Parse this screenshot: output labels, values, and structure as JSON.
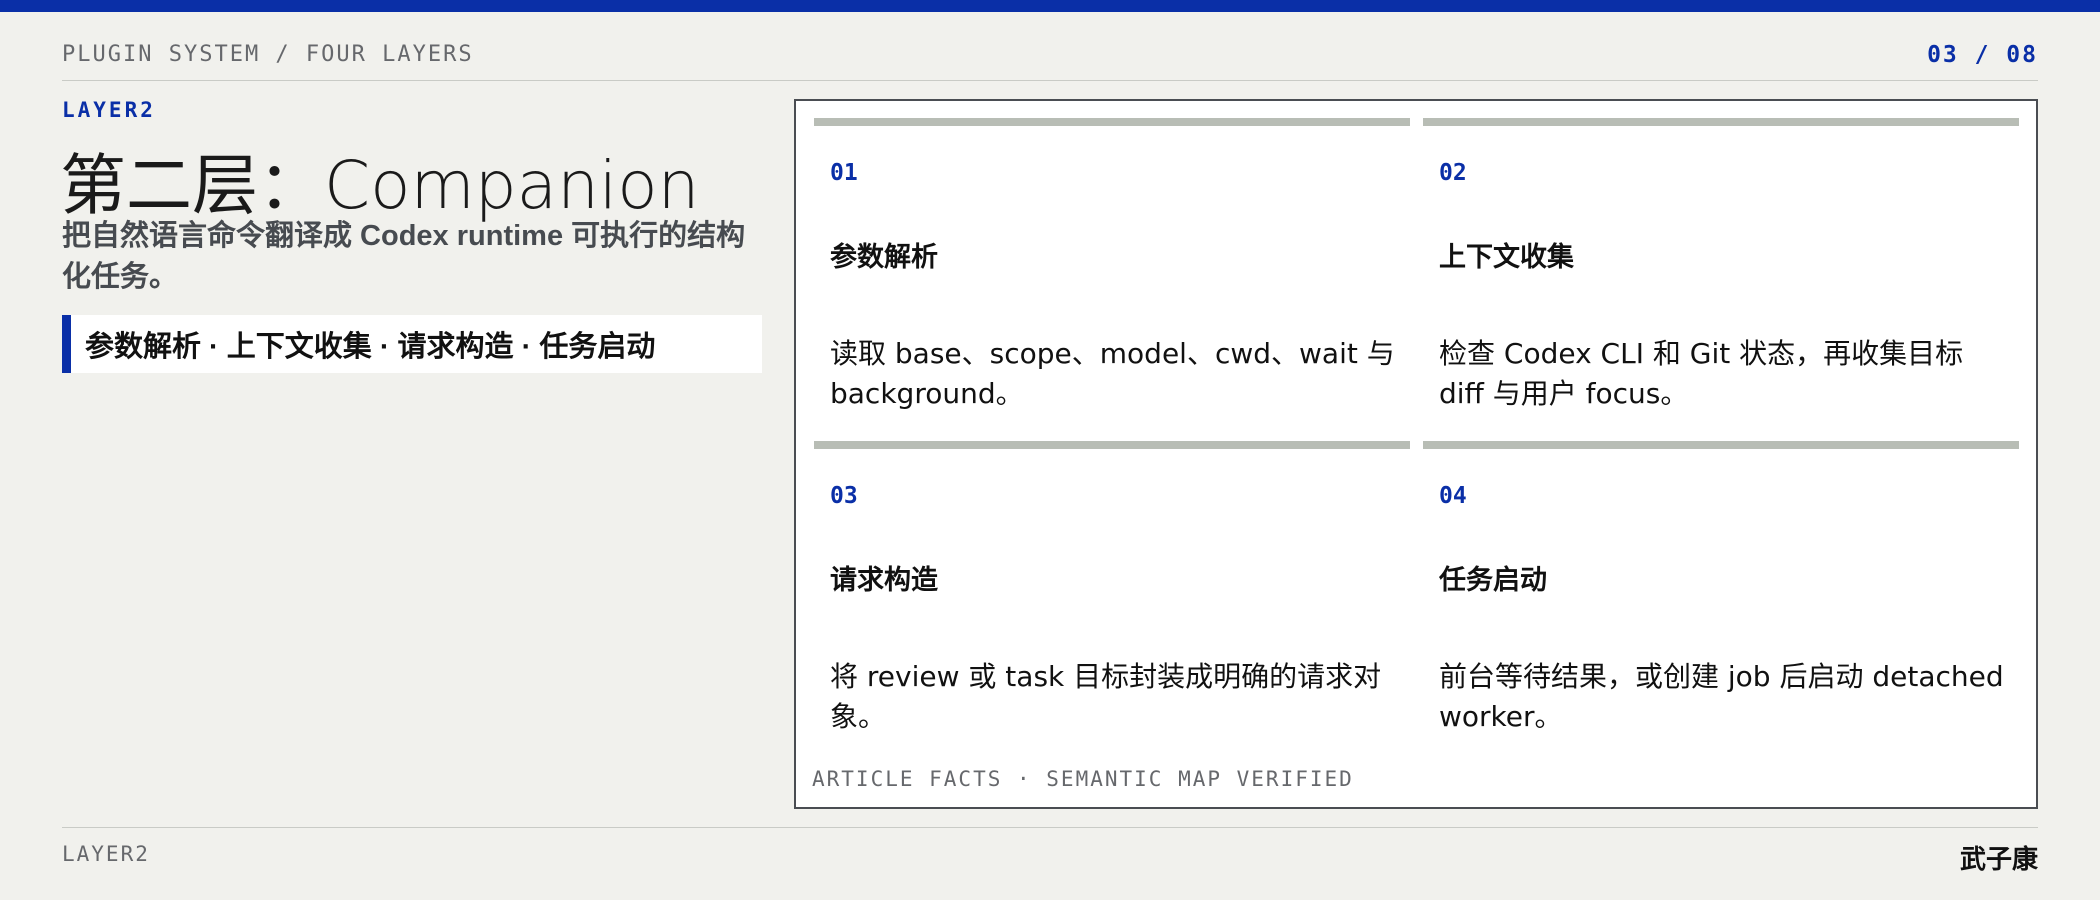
{
  "header": {
    "section": "PLUGIN SYSTEM / FOUR LAYERS",
    "page_indicator": "03 / 08"
  },
  "slide": {
    "eyebrow": "LAYER2",
    "title": "第二层：Companion",
    "subtitle": "把自然语言命令翻译成 Codex runtime 可执行的结构化任务。",
    "keyline": "参数解析 · 上下文收集 · 请求构造 · 任务启动"
  },
  "cards": [
    {
      "number": "01",
      "title": "参数解析",
      "body": "读取 base、scope、model、cwd、wait 与 background。"
    },
    {
      "number": "02",
      "title": "上下文收集",
      "body": "检查 Codex CLI 和 Git 状态，再收集目标 diff 与用户 focus。"
    },
    {
      "number": "03",
      "title": "请求构造",
      "body": "将 review 或 task 目标封装成明确的请求对象。"
    },
    {
      "number": "04",
      "title": "任务启动",
      "body": "前台等待结果，或创建 job 后启动 detached worker。"
    }
  ],
  "panel_footer": "ARTICLE FACTS · SEMANTIC MAP VERIFIED",
  "footer": {
    "left": "LAYER2",
    "author": "武子康"
  },
  "colors": {
    "accent": "#0a2fa7",
    "background": "#f1f1ed",
    "card_bar": "#b8bdb5"
  }
}
